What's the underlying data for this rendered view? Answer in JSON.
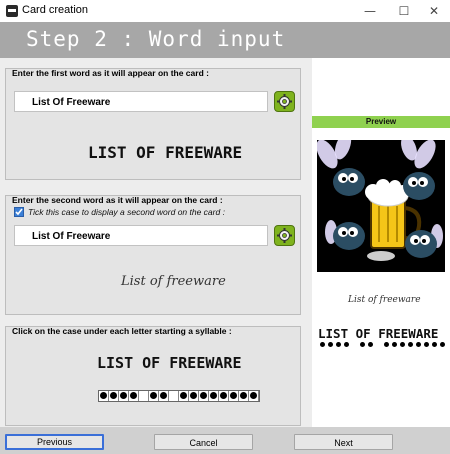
{
  "window": {
    "title": "Card creation",
    "controls": {
      "minimize": "—",
      "maximize": "☐",
      "close": "✕"
    }
  },
  "step_title": "Step 2 : Word input",
  "first_word": {
    "instruction": "Enter the first word as it will appear on the card :",
    "value": "List Of Freeware",
    "display": "LIST OF FREEWARE"
  },
  "second_word": {
    "instruction": "Enter the second word as it will appear on the card :",
    "checkbox_label": "Tick this case to display a second word on the card :",
    "checkbox_checked": true,
    "value": "List Of Freeware",
    "display": "List of freeware"
  },
  "syllables": {
    "instruction": "Click on the case under each letter starting a syllable :",
    "display": "LIST OF FREEWARE",
    "markers": [
      1,
      1,
      1,
      1,
      0,
      1,
      1,
      0,
      1,
      1,
      1,
      1,
      1,
      1,
      1,
      1
    ]
  },
  "preview": {
    "label": "Preview",
    "cursive_word": "List of freeware",
    "caps_word": "LIST OF FREEWARE",
    "markers": [
      1,
      1,
      1,
      1,
      0,
      1,
      1,
      0,
      1,
      1,
      1,
      1,
      1,
      1,
      1,
      1
    ]
  },
  "buttons": {
    "previous": "Previous",
    "cancel": "Cancel",
    "next": "Next"
  },
  "colors": {
    "accent_green": "#8fd14f",
    "gear_green": "#7fb31e",
    "header_gray": "#a7a7a7",
    "focus_blue": "#3a6fd8"
  }
}
